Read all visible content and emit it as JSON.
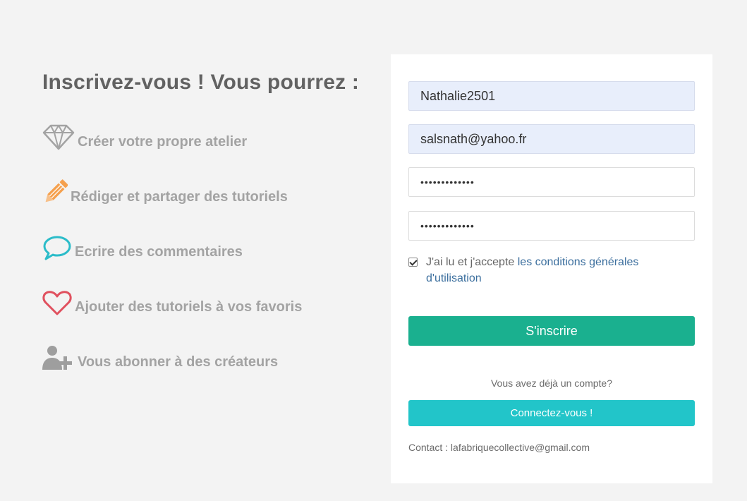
{
  "left": {
    "title": "Inscrivez-vous ! Vous pourrez :",
    "features": [
      {
        "icon": "diamond-icon",
        "label": "Créer votre propre atelier"
      },
      {
        "icon": "pencil-icon",
        "label": "Rédiger et partager des tutoriels"
      },
      {
        "icon": "speech-bubble-icon",
        "label": "Ecrire des commentaires"
      },
      {
        "icon": "heart-icon",
        "label": "Ajouter des tutoriels à vos favoris"
      },
      {
        "icon": "user-add-icon",
        "label": "Vous abonner à des créateurs"
      }
    ],
    "colors": {
      "diamond": "#a3a3a3",
      "pencil": "#f5a04d",
      "bubble": "#2bbcc9",
      "heart": "#e0505e",
      "user": "#9e9e9e"
    }
  },
  "form": {
    "username_value": "Nathalie2501",
    "email_value": "salsnath@yahoo.fr",
    "password_value": "•••••••••••••",
    "password_confirm_value": "•••••••••••••",
    "terms_checked": true,
    "terms_prefix": "J'ai lu et j'accepte ",
    "terms_link": "les conditions générales d'utilisation",
    "signup_label": "S'inscrire",
    "have_account_text": "Vous avez déjà un compte?",
    "login_label": "Connectez-vous !",
    "contact_text": "Contact : lafabriquecollective@gmail.com"
  },
  "colors": {
    "signup_button": "#1ab08f",
    "login_button": "#22c5c9",
    "link": "#3c6f9e",
    "autofill_bg": "#e8eefb"
  }
}
